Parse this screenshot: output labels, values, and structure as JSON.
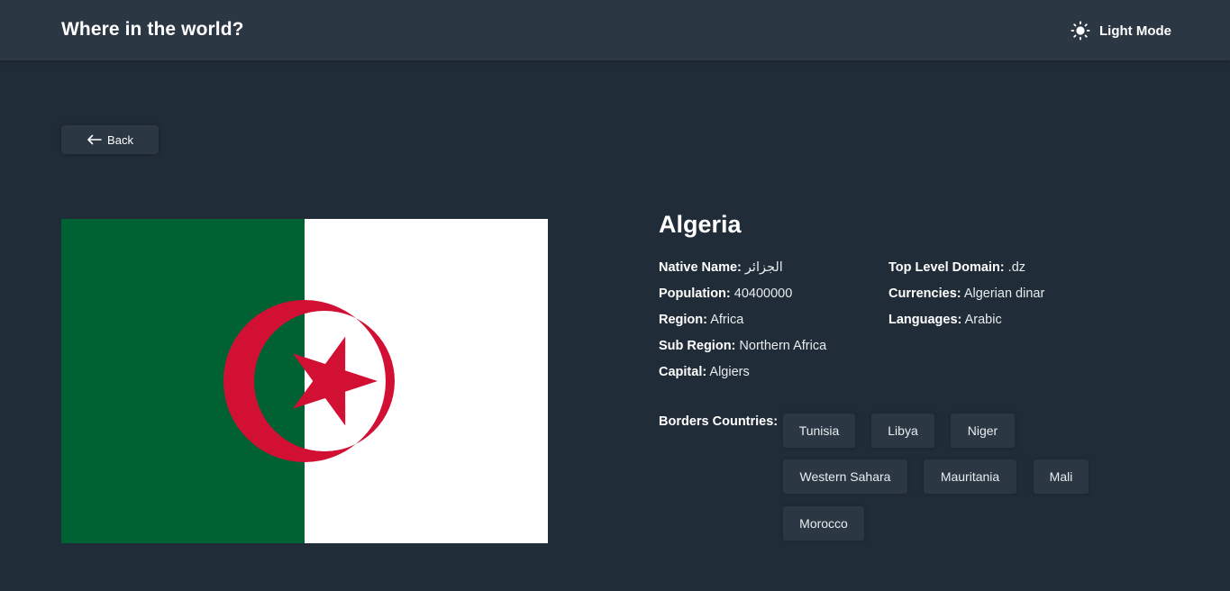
{
  "header": {
    "title": "Where in the world?",
    "mode_label": "Light Mode",
    "mode_icon": "sun-icon"
  },
  "back_button": {
    "label": "Back",
    "icon": "arrow-left-icon"
  },
  "flag": {
    "alt_colors": {
      "green": "#006233",
      "white": "#ffffff",
      "red": "#d21034"
    }
  },
  "country": {
    "name": "Algeria",
    "native_name": {
      "label": "Native Name:",
      "value": "الجزائر"
    },
    "population": {
      "label": "Population:",
      "value": "40400000"
    },
    "region": {
      "label": "Region:",
      "value": "Africa"
    },
    "sub_region": {
      "label": "Sub Region:",
      "value": "Northern Africa"
    },
    "capital": {
      "label": "Capital:",
      "value": "Algiers"
    },
    "top_level_domain": {
      "label": "Top Level Domain:",
      "value": ".dz"
    },
    "currencies": {
      "label": "Currencies:",
      "value": "Algerian dinar"
    },
    "languages": {
      "label": "Languages:",
      "value": "Arabic"
    }
  },
  "borders": {
    "label": "Borders Countries:",
    "countries": [
      "Tunisia",
      "Libya",
      "Niger",
      "Western Sahara",
      "Mauritania",
      "Mali",
      "Morocco"
    ]
  },
  "colors": {
    "background": "#202c37",
    "elements": "#2b3844",
    "text": "#ffffff"
  }
}
